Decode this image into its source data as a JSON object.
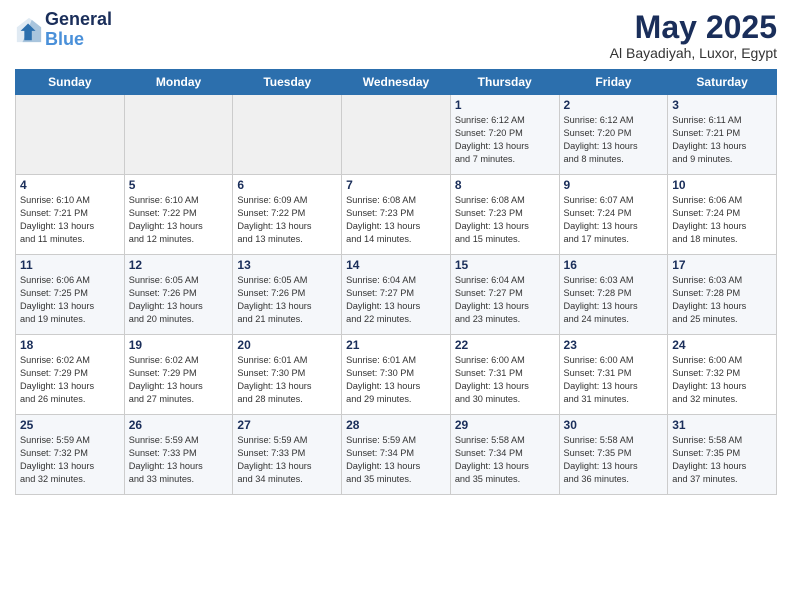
{
  "logo": {
    "line1": "General",
    "line2": "Blue"
  },
  "title": "May 2025",
  "subtitle": "Al Bayadiyah, Luxor, Egypt",
  "days_of_week": [
    "Sunday",
    "Monday",
    "Tuesday",
    "Wednesday",
    "Thursday",
    "Friday",
    "Saturday"
  ],
  "weeks": [
    [
      {
        "day": "",
        "info": ""
      },
      {
        "day": "",
        "info": ""
      },
      {
        "day": "",
        "info": ""
      },
      {
        "day": "",
        "info": ""
      },
      {
        "day": "1",
        "info": "Sunrise: 6:12 AM\nSunset: 7:20 PM\nDaylight: 13 hours\nand 7 minutes."
      },
      {
        "day": "2",
        "info": "Sunrise: 6:12 AM\nSunset: 7:20 PM\nDaylight: 13 hours\nand 8 minutes."
      },
      {
        "day": "3",
        "info": "Sunrise: 6:11 AM\nSunset: 7:21 PM\nDaylight: 13 hours\nand 9 minutes."
      }
    ],
    [
      {
        "day": "4",
        "info": "Sunrise: 6:10 AM\nSunset: 7:21 PM\nDaylight: 13 hours\nand 11 minutes."
      },
      {
        "day": "5",
        "info": "Sunrise: 6:10 AM\nSunset: 7:22 PM\nDaylight: 13 hours\nand 12 minutes."
      },
      {
        "day": "6",
        "info": "Sunrise: 6:09 AM\nSunset: 7:22 PM\nDaylight: 13 hours\nand 13 minutes."
      },
      {
        "day": "7",
        "info": "Sunrise: 6:08 AM\nSunset: 7:23 PM\nDaylight: 13 hours\nand 14 minutes."
      },
      {
        "day": "8",
        "info": "Sunrise: 6:08 AM\nSunset: 7:23 PM\nDaylight: 13 hours\nand 15 minutes."
      },
      {
        "day": "9",
        "info": "Sunrise: 6:07 AM\nSunset: 7:24 PM\nDaylight: 13 hours\nand 17 minutes."
      },
      {
        "day": "10",
        "info": "Sunrise: 6:06 AM\nSunset: 7:24 PM\nDaylight: 13 hours\nand 18 minutes."
      }
    ],
    [
      {
        "day": "11",
        "info": "Sunrise: 6:06 AM\nSunset: 7:25 PM\nDaylight: 13 hours\nand 19 minutes."
      },
      {
        "day": "12",
        "info": "Sunrise: 6:05 AM\nSunset: 7:26 PM\nDaylight: 13 hours\nand 20 minutes."
      },
      {
        "day": "13",
        "info": "Sunrise: 6:05 AM\nSunset: 7:26 PM\nDaylight: 13 hours\nand 21 minutes."
      },
      {
        "day": "14",
        "info": "Sunrise: 6:04 AM\nSunset: 7:27 PM\nDaylight: 13 hours\nand 22 minutes."
      },
      {
        "day": "15",
        "info": "Sunrise: 6:04 AM\nSunset: 7:27 PM\nDaylight: 13 hours\nand 23 minutes."
      },
      {
        "day": "16",
        "info": "Sunrise: 6:03 AM\nSunset: 7:28 PM\nDaylight: 13 hours\nand 24 minutes."
      },
      {
        "day": "17",
        "info": "Sunrise: 6:03 AM\nSunset: 7:28 PM\nDaylight: 13 hours\nand 25 minutes."
      }
    ],
    [
      {
        "day": "18",
        "info": "Sunrise: 6:02 AM\nSunset: 7:29 PM\nDaylight: 13 hours\nand 26 minutes."
      },
      {
        "day": "19",
        "info": "Sunrise: 6:02 AM\nSunset: 7:29 PM\nDaylight: 13 hours\nand 27 minutes."
      },
      {
        "day": "20",
        "info": "Sunrise: 6:01 AM\nSunset: 7:30 PM\nDaylight: 13 hours\nand 28 minutes."
      },
      {
        "day": "21",
        "info": "Sunrise: 6:01 AM\nSunset: 7:30 PM\nDaylight: 13 hours\nand 29 minutes."
      },
      {
        "day": "22",
        "info": "Sunrise: 6:00 AM\nSunset: 7:31 PM\nDaylight: 13 hours\nand 30 minutes."
      },
      {
        "day": "23",
        "info": "Sunrise: 6:00 AM\nSunset: 7:31 PM\nDaylight: 13 hours\nand 31 minutes."
      },
      {
        "day": "24",
        "info": "Sunrise: 6:00 AM\nSunset: 7:32 PM\nDaylight: 13 hours\nand 32 minutes."
      }
    ],
    [
      {
        "day": "25",
        "info": "Sunrise: 5:59 AM\nSunset: 7:32 PM\nDaylight: 13 hours\nand 32 minutes."
      },
      {
        "day": "26",
        "info": "Sunrise: 5:59 AM\nSunset: 7:33 PM\nDaylight: 13 hours\nand 33 minutes."
      },
      {
        "day": "27",
        "info": "Sunrise: 5:59 AM\nSunset: 7:33 PM\nDaylight: 13 hours\nand 34 minutes."
      },
      {
        "day": "28",
        "info": "Sunrise: 5:59 AM\nSunset: 7:34 PM\nDaylight: 13 hours\nand 35 minutes."
      },
      {
        "day": "29",
        "info": "Sunrise: 5:58 AM\nSunset: 7:34 PM\nDaylight: 13 hours\nand 35 minutes."
      },
      {
        "day": "30",
        "info": "Sunrise: 5:58 AM\nSunset: 7:35 PM\nDaylight: 13 hours\nand 36 minutes."
      },
      {
        "day": "31",
        "info": "Sunrise: 5:58 AM\nSunset: 7:35 PM\nDaylight: 13 hours\nand 37 minutes."
      }
    ]
  ]
}
